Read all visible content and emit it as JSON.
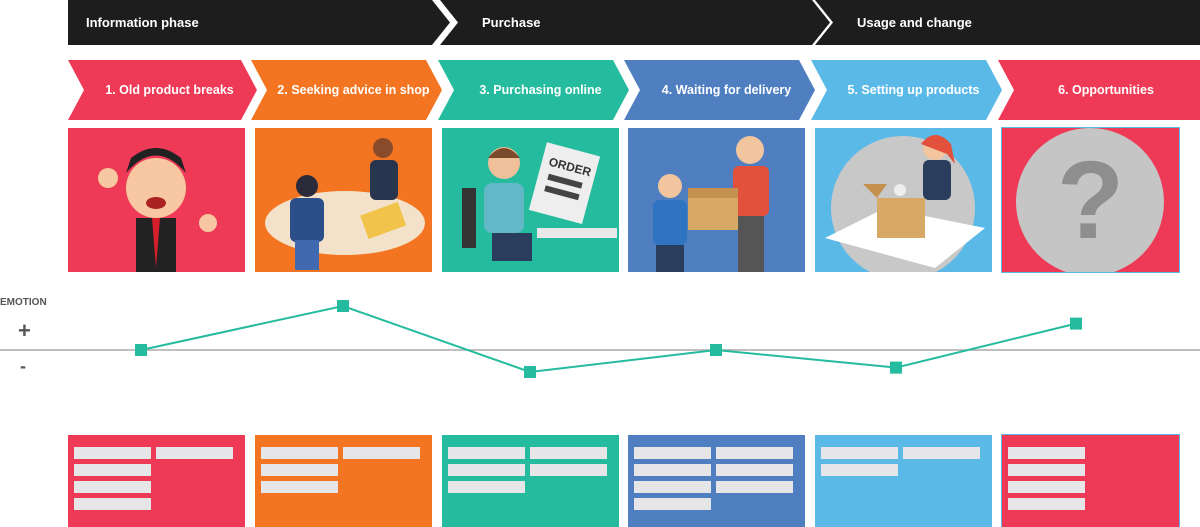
{
  "phases": [
    {
      "label": "Information phase"
    },
    {
      "label": "Purchase"
    },
    {
      "label": "Usage and change"
    }
  ],
  "steps": [
    {
      "label": "1. Old product breaks",
      "color": "#ef3a57",
      "illustration": "frustrated-man",
      "cards": [
        2,
        1,
        1,
        1
      ]
    },
    {
      "label": "2. Seeking advice in shop",
      "color": "#f47521",
      "illustration": "shop-counter",
      "cards": [
        2,
        1,
        1
      ]
    },
    {
      "label": "3. Purchasing online",
      "color": "#25bb9e",
      "illustration": "computer-order",
      "cards": [
        2,
        2,
        1
      ]
    },
    {
      "label": "4. Waiting for delivery",
      "color": "#4f7fc1",
      "illustration": "package-delivery",
      "cards": [
        2,
        2,
        2,
        1
      ]
    },
    {
      "label": "5. Setting up products",
      "color": "#5bb9e8",
      "illustration": "unboxing",
      "cards": [
        2,
        1
      ]
    },
    {
      "label": "6. Opportunities",
      "color": "#ef3a57",
      "illustration": "question-mark",
      "cards": [
        1,
        1,
        1,
        1
      ]
    }
  ],
  "question_mark": "?",
  "emotion": {
    "label": "EMOTION",
    "plus": "+",
    "minus": "-",
    "line_color": "#25bb9e"
  },
  "chart_data": {
    "type": "line",
    "ylabel": "EMOTION",
    "ylim": [
      -1,
      1
    ],
    "values": [
      0,
      1,
      -0.5,
      0,
      -0.4,
      0.6
    ]
  }
}
